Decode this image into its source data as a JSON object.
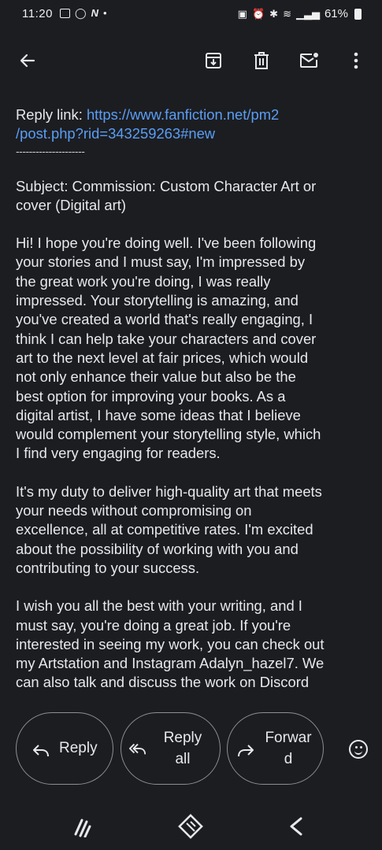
{
  "status_bar": {
    "time": "11:20",
    "battery": "61%"
  },
  "toolbar": {
    "back_icon": "arrow-left-icon",
    "actions": [
      "archive-icon",
      "delete-icon",
      "mark-unread-icon",
      "more-vert-icon"
    ]
  },
  "message": {
    "reply_link_label": "Reply link: ",
    "reply_link_url_line1": "https://www.fanfiction.net/pm2",
    "reply_link_url_line2": "/post.php?rid=343259263#new",
    "separator": "---------------------",
    "subject_line1": "Subject: Commission: Custom Character Art or",
    "subject_line2": "cover (Digital art)",
    "paragraph1": [
      "Hi! I hope you're doing well. I've been following",
      "your stories and I must say, I'm impressed by",
      "the great work you're doing, I was really",
      "impressed. Your storytelling is amazing, and",
      "you've created a world that's really engaging, I",
      "think I can help take your characters and cover",
      "art to the next level at fair prices, which would",
      "not only enhance their value but also be the",
      "best option for improving your books. As a",
      "digital artist, I have some ideas that I believe",
      "would complement your storytelling style, which",
      "I find very engaging for readers."
    ],
    "paragraph2": [
      "It's my duty to deliver high-quality art that meets",
      "your needs without compromising on",
      "excellence, all at competitive rates. I'm excited",
      "about the possibility of working with you and",
      "contributing to your success."
    ],
    "paragraph3": [
      "I wish you all the best with your writing, and I",
      "must say, you're doing a great job. If you're",
      "interested in seeing my work, you can check out",
      "my Artstation and Instagram Adalyn_hazel7. We",
      "can also talk and discuss the work on Discord"
    ]
  },
  "actions": {
    "reply": "Reply",
    "reply_all_line1": "Reply",
    "reply_all_line2": "all",
    "forward_line1": "Forwar",
    "forward_line2": "d"
  },
  "colors": {
    "background": "#1c1d21",
    "text": "#e7e8ec",
    "link": "#5a9ef5",
    "outline": "#8d8f94"
  }
}
